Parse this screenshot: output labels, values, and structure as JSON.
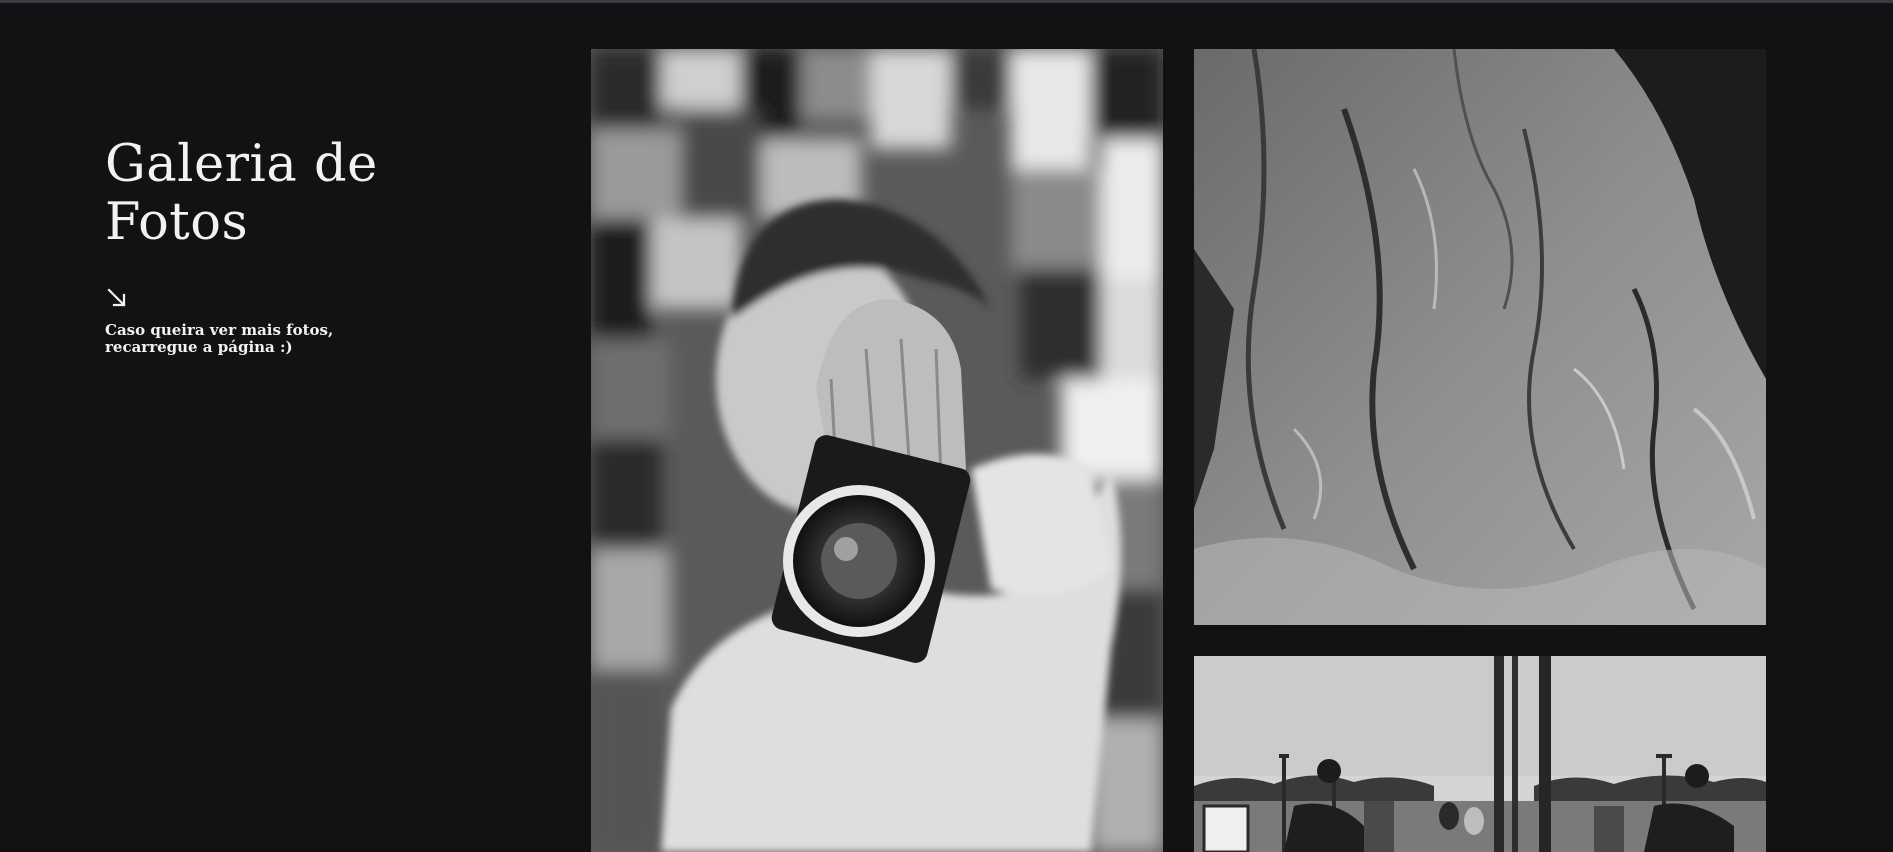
{
  "gallery": {
    "title_line1": "Galeria de",
    "title_line2": "Fotos",
    "arrow_icon": "arrow-down-right-icon",
    "note_line1": "Caso queira ver mais fotos,",
    "note_line2": "recarregue a página :)"
  },
  "photos": [
    {
      "subject": "person-holding-camera"
    },
    {
      "subject": "rock-cliff"
    },
    {
      "subject": "street-scene"
    }
  ],
  "colors": {
    "background": "#121214",
    "text": "#f2f2f2",
    "top_line": "#3c3c40"
  }
}
